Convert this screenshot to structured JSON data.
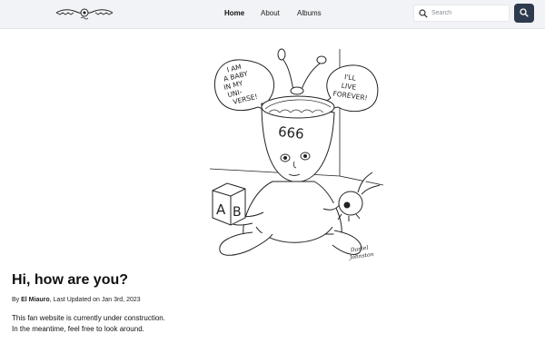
{
  "nav": {
    "links": [
      {
        "label": "Home",
        "active": true
      },
      {
        "label": "About"
      },
      {
        "label": "Albums"
      }
    ]
  },
  "search": {
    "placeholder": "Search"
  },
  "art": {
    "bubble_left": [
      "I AM",
      "A BABY",
      "IN MY",
      "UNI-",
      "VERSE!"
    ],
    "bubble_right": [
      "I'LL",
      "LIVE",
      "FOREVER!"
    ],
    "head_numbers": "666",
    "block_letters": [
      "A",
      "B"
    ],
    "signature": [
      "Daniel",
      "Johnston"
    ]
  },
  "hero": {
    "title": "Hi, how are you?",
    "byline_prefix": "By ",
    "author": "El Miauro",
    "byline_suffix": ", Last Updated on Jan 3rd, 2023",
    "intro_lines": [
      "This fan website is currently under construction.",
      "In the meantime, feel free to look around."
    ]
  },
  "colors": {
    "navbar_bg": "#f1f3f6",
    "search_button_bg": "#2e3a4d"
  }
}
